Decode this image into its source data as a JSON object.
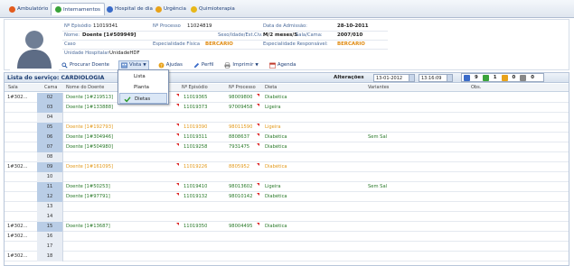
{
  "tabs": [
    {
      "label": "Ambulatório",
      "color": "#e35b1d",
      "active": false
    },
    {
      "label": "Internamentos",
      "color": "#3aa33a",
      "active": true
    },
    {
      "label": "Hospital de dia",
      "color": "#3a6bc9",
      "active": false
    },
    {
      "label": "Urgência",
      "color": "#e8a21a",
      "active": false
    },
    {
      "label": "Quimioterapia",
      "color": "#e8b81a",
      "active": false
    }
  ],
  "patient": {
    "episodio_label": "Nº Episódio",
    "episodio_value": "11019341",
    "processo_label": "Nº Processo",
    "processo_value": "11024819",
    "admissao_label": "Data de Admissão:",
    "admissao_value": "28-10-2011",
    "nome_label": "Nome:",
    "nome_value": "Doente [1#509949]",
    "sexo_label": "Sexo/Idade/Est.Civ.:",
    "sexo_value": "M/2 meses/S",
    "sala_label": "Sala/Cama:",
    "sala_value": "2007/010",
    "caso_label": "Caso",
    "esp_fisica_label": "Especialidade Física",
    "esp_fisica_value": "BERCARIO",
    "esp_resp_label": "Especialidade Responsável:",
    "esp_resp_value": "BERCARIO",
    "unidade_label": "Unidade Hospitalar",
    "unidade_value": "UnidadeHDF"
  },
  "toolbar": {
    "procurar": "Procurar Doente",
    "vista": "Vista",
    "ajudas": "Ajudas",
    "perfil": "Perfil",
    "imprimir": "Imprimir",
    "agenda": "Agenda"
  },
  "vista_menu": [
    {
      "label": "Lista",
      "selected": false
    },
    {
      "label": "Planta",
      "selected": false
    },
    {
      "label": "Dietas",
      "selected": true
    }
  ],
  "list": {
    "title": "Lista do serviço: CARDIOLOGIA",
    "alteracoes_label": "Alterações",
    "date_value": "13-01-2012",
    "time_value": "13:16:09",
    "counts": [
      "9",
      "1",
      "0",
      "0"
    ]
  },
  "columns": {
    "sala": "Sala",
    "cama": "Cama",
    "nome": "Nome do Doente",
    "episodio": "Nº Episódio",
    "processo": "Nº Processo",
    "dieta": "Dieta",
    "variantes": "Variantes",
    "obs": "Obs."
  },
  "rows": [
    {
      "sala": "1#302...",
      "cama": "02",
      "nome": "Doente [1#219513]",
      "episodio": "11019365",
      "processo": "98009800",
      "dieta": "Diabética",
      "variantes": "",
      "status": "occupied"
    },
    {
      "sala": "",
      "cama": "03",
      "nome": "Doente [1#133888]",
      "episodio": "11019373",
      "processo": "97009458",
      "dieta": "Ligeira",
      "variantes": "",
      "status": "occupied"
    },
    {
      "sala": "",
      "cama": "04",
      "nome": "",
      "episodio": "",
      "processo": "",
      "dieta": "",
      "variantes": "",
      "status": "empty"
    },
    {
      "sala": "",
      "cama": "05",
      "nome": "Doente [1#192793]",
      "episodio": "11019390",
      "processo": "98011590",
      "dieta": "Ligeira",
      "variantes": "",
      "status": "pending"
    },
    {
      "sala": "",
      "cama": "06",
      "nome": "Doente [1#304946]",
      "episodio": "11019311",
      "processo": "8808637",
      "dieta": "Diabética",
      "variantes": "Sem Sal",
      "status": "occupied"
    },
    {
      "sala": "",
      "cama": "07",
      "nome": "Doente [1#504980]",
      "episodio": "11019258",
      "processo": "7931475",
      "dieta": "Diabética",
      "variantes": "",
      "status": "occupied"
    },
    {
      "sala": "",
      "cama": "08",
      "nome": "",
      "episodio": "",
      "processo": "",
      "dieta": "",
      "variantes": "",
      "status": "empty"
    },
    {
      "sala": "1#302...",
      "cama": "09",
      "nome": "Doente [1#161095]",
      "episodio": "11019226",
      "processo": "8805952",
      "dieta": "Diabética",
      "variantes": "",
      "status": "pending"
    },
    {
      "sala": "",
      "cama": "10",
      "nome": "",
      "episodio": "",
      "processo": "",
      "dieta": "",
      "variantes": "",
      "status": "empty"
    },
    {
      "sala": "",
      "cama": "11",
      "nome": "Doente [1#50253]",
      "episodio": "11019410",
      "processo": "98013602",
      "dieta": "Ligeira",
      "variantes": "Sem Sal",
      "status": "occupied"
    },
    {
      "sala": "",
      "cama": "12",
      "nome": "Doente [1#97791]",
      "episodio": "11019132",
      "processo": "98010142",
      "dieta": "Diabética",
      "variantes": "",
      "status": "occupied"
    },
    {
      "sala": "",
      "cama": "13",
      "nome": "",
      "episodio": "",
      "processo": "",
      "dieta": "",
      "variantes": "",
      "status": "empty"
    },
    {
      "sala": "",
      "cama": "14",
      "nome": "",
      "episodio": "",
      "processo": "",
      "dieta": "",
      "variantes": "",
      "status": "empty"
    },
    {
      "sala": "1#302...",
      "cama": "15",
      "nome": "Doente [1#13687]",
      "episodio": "11019350",
      "processo": "98004495",
      "dieta": "Diabética",
      "variantes": "",
      "status": "occupied"
    },
    {
      "sala": "1#302...",
      "cama": "16",
      "nome": "",
      "episodio": "",
      "processo": "",
      "dieta": "",
      "variantes": "",
      "status": "empty"
    },
    {
      "sala": "",
      "cama": "17",
      "nome": "",
      "episodio": "",
      "processo": "",
      "dieta": "",
      "variantes": "",
      "status": "empty"
    },
    {
      "sala": "1#302...",
      "cama": "18",
      "nome": "",
      "episodio": "",
      "processo": "",
      "dieta": "",
      "variantes": "",
      "status": "empty"
    }
  ],
  "colors": {
    "occupied_text": "#2a7a2a",
    "pending_text": "#e39a1c",
    "header_blue": "#1f3f73"
  },
  "icons": {
    "search": "search-icon",
    "vista": "view-icon",
    "ajudas": "help-icon",
    "perfil": "pencil-icon",
    "imprimir": "print-icon",
    "agenda": "calendar-icon"
  }
}
